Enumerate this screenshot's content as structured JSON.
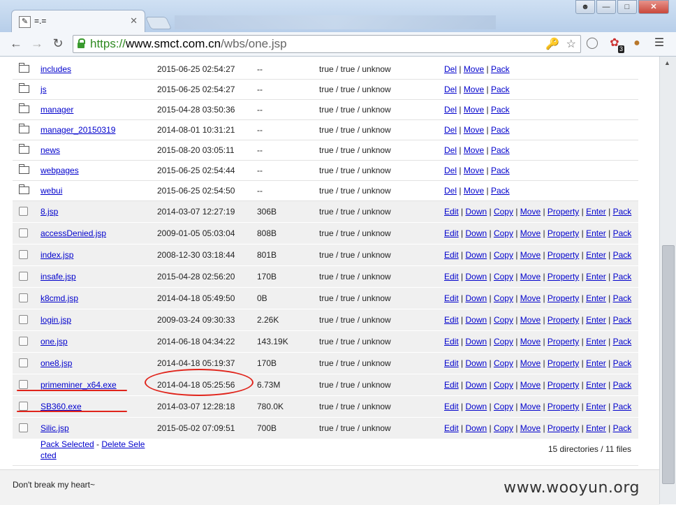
{
  "browser": {
    "tab_title": "=.=",
    "url_scheme": "https://",
    "url_host": "www.smct.com.cn",
    "url_path": "/wbs/one.jsp",
    "extension_badge": "3"
  },
  "directories": [
    {
      "name": "includes",
      "date": "2015-06-25 02:54:27",
      "size": "--",
      "perm": "true / true / unknow"
    },
    {
      "name": "js",
      "date": "2015-06-25 02:54:27",
      "size": "--",
      "perm": "true / true / unknow"
    },
    {
      "name": "manager",
      "date": "2015-04-28 03:50:36",
      "size": "--",
      "perm": "true / true / unknow"
    },
    {
      "name": "manager_20150319",
      "date": "2014-08-01 10:31:21",
      "size": "--",
      "perm": "true / true / unknow"
    },
    {
      "name": "news",
      "date": "2015-08-20 03:05:11",
      "size": "--",
      "perm": "true / true / unknow"
    },
    {
      "name": "webpages",
      "date": "2015-06-25 02:54:44",
      "size": "--",
      "perm": "true / true / unknow"
    },
    {
      "name": "webui",
      "date": "2015-06-25 02:54:50",
      "size": "--",
      "perm": "true / true / unknow"
    }
  ],
  "dir_actions": [
    "Del",
    "Move",
    "Pack"
  ],
  "files": [
    {
      "name": "8.jsp",
      "date": "2014-03-07 12:27:19",
      "size": "306B",
      "perm": "true / true / unknow"
    },
    {
      "name": "accessDenied.jsp",
      "date": "2009-01-05 05:03:04",
      "size": "808B",
      "perm": "true / true / unknow"
    },
    {
      "name": "index.jsp",
      "date": "2008-12-30 03:18:44",
      "size": "801B",
      "perm": "true / true / unknow"
    },
    {
      "name": "insafe.jsp",
      "date": "2015-04-28 02:56:20",
      "size": "170B",
      "perm": "true / true / unknow"
    },
    {
      "name": "k8cmd.jsp",
      "date": "2014-04-18 05:49:50",
      "size": "0B",
      "perm": "true / true / unknow"
    },
    {
      "name": "login.jsp",
      "date": "2009-03-24 09:30:33",
      "size": "2.26K",
      "perm": "true / true / unknow"
    },
    {
      "name": "one.jsp",
      "date": "2014-06-18 04:34:22",
      "size": "143.19K",
      "perm": "true / true / unknow"
    },
    {
      "name": "one8.jsp",
      "date": "2014-04-18 05:19:37",
      "size": "170B",
      "perm": "true / true / unknow"
    },
    {
      "name": "primeminer_x64.exe",
      "date": "2014-04-18 05:25:56",
      "size": "6.73M",
      "perm": "true / true / unknow"
    },
    {
      "name": "SB360.exe",
      "date": "2014-03-07 12:28:18",
      "size": "780.0K",
      "perm": "true / true / unknow"
    },
    {
      "name": "Silic.jsp",
      "date": "2015-05-02 07:09:51",
      "size": "700B",
      "perm": "true / true / unknow"
    }
  ],
  "file_actions": [
    "Edit",
    "Down",
    "Copy",
    "Move",
    "Property",
    "Enter",
    "Pack"
  ],
  "footer": {
    "pack_selected": "Pack Selected",
    "separator": " - ",
    "delete_selected": "Delete Sele cted",
    "summary": "15 directories / 11 files"
  },
  "status_text": "Don't break my heart~",
  "watermark": "www.wooyun.org",
  "annotation_color": "#e0241b"
}
